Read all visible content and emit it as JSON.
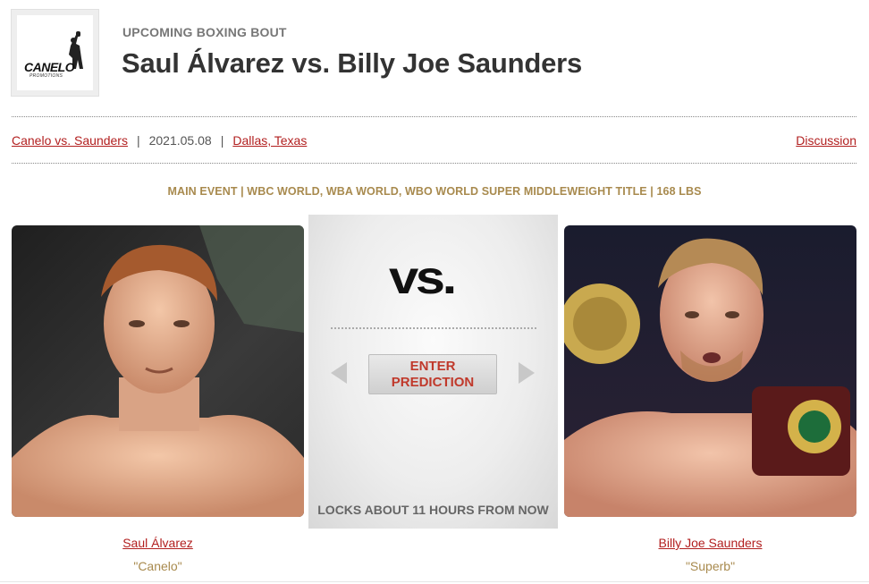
{
  "header": {
    "logo_text": "CANELO",
    "logo_subtext": "PROMOTIONS",
    "kicker": "UPCOMING BOXING BOUT",
    "title": "Saul Álvarez vs. Billy Joe Saunders"
  },
  "meta": {
    "event_link": "Canelo vs. Saunders",
    "separator": "|",
    "date": "2021.05.08",
    "location_link": "Dallas, Texas",
    "discussion_link": "Discussion"
  },
  "event_info": "MAIN EVENT | WBC WORLD, WBA WORLD, WBO WORLD SUPER MIDDLEWEIGHT TITLE | 168 LBS",
  "center": {
    "vs_text": "vs.",
    "predict_label_1": "ENTER",
    "predict_label_2": "PREDICTION",
    "locks_text": "LOCKS ABOUT 11 HOURS FROM NOW"
  },
  "fighters": {
    "left": {
      "name": "Saul Álvarez",
      "nickname": "\"Canelo\""
    },
    "right": {
      "name": "Billy Joe Saunders",
      "nickname": "\"Superb\""
    }
  },
  "colors": {
    "link": "#b21f1f",
    "gold": "#a88a4e",
    "predict_text": "#c0392b"
  },
  "icons": {
    "prev": "chevron-left-icon",
    "next": "chevron-right-icon"
  }
}
